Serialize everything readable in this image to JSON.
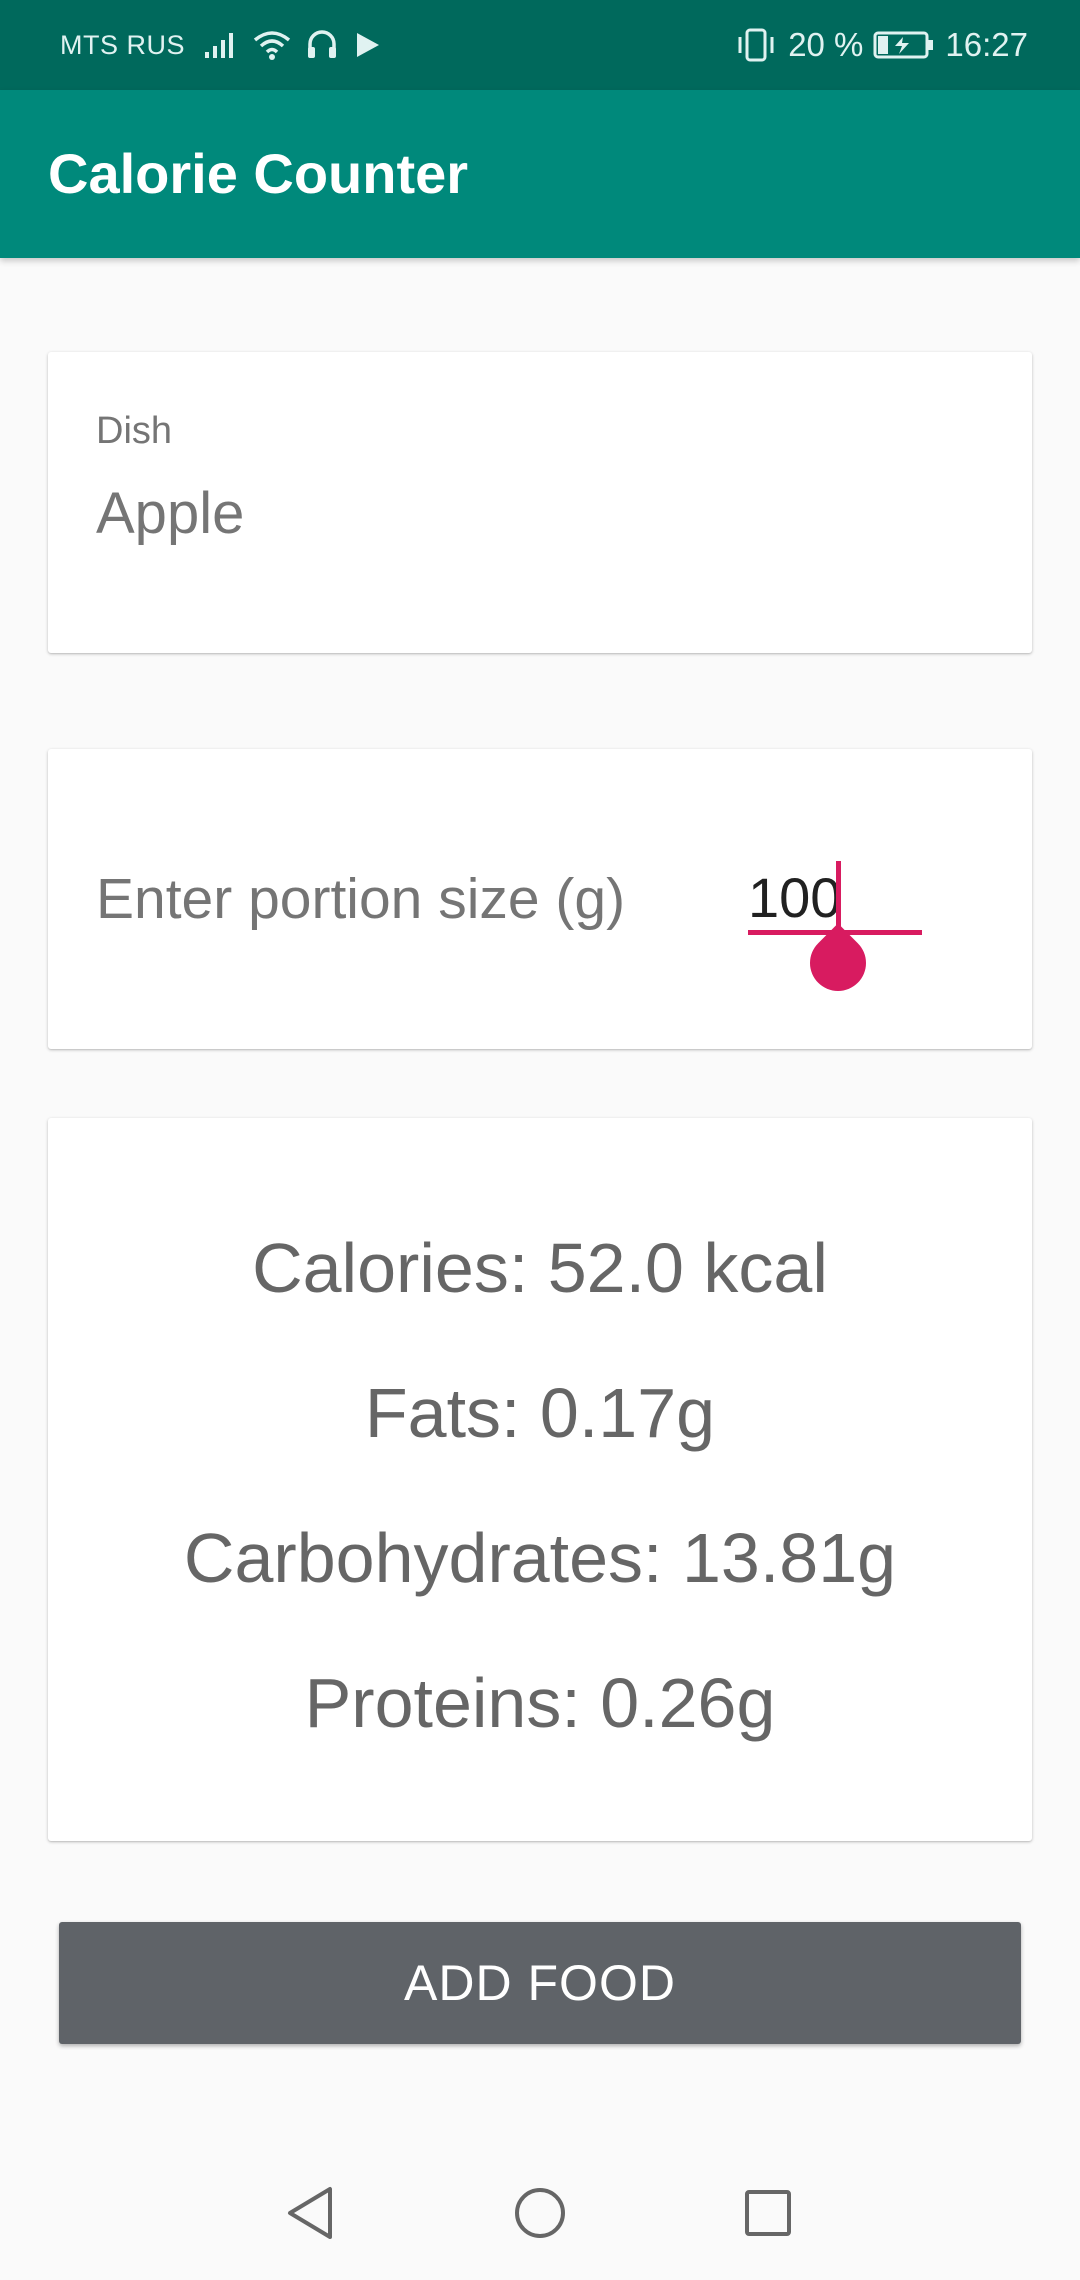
{
  "status_bar": {
    "carrier": "MTS RUS",
    "battery": "20 %",
    "time": "16:27",
    "icons": [
      "signal-icon",
      "wifi-icon",
      "headset-icon",
      "play-icon",
      "vibrate-icon",
      "battery-icon"
    ]
  },
  "app_bar": {
    "title": "Calorie Counter"
  },
  "dish": {
    "label": "Dish",
    "value": "Apple"
  },
  "portion": {
    "label": "Enter portion size (g)",
    "value": "100"
  },
  "nutrition": {
    "calories": "Calories: 52.0 kcal",
    "fats": "Fats: 0.17g",
    "carbohydrates": "Carbohydrates: 13.81g",
    "proteins": "Proteins: 0.26g"
  },
  "button": {
    "label": "ADD FOOD"
  },
  "nav": {
    "icons": [
      "back-icon",
      "home-icon",
      "recents-icon"
    ]
  },
  "colors": {
    "primary": "#00897b",
    "primary_dark": "#00695c",
    "accent": "#d81b60",
    "button": "#5f6368"
  }
}
